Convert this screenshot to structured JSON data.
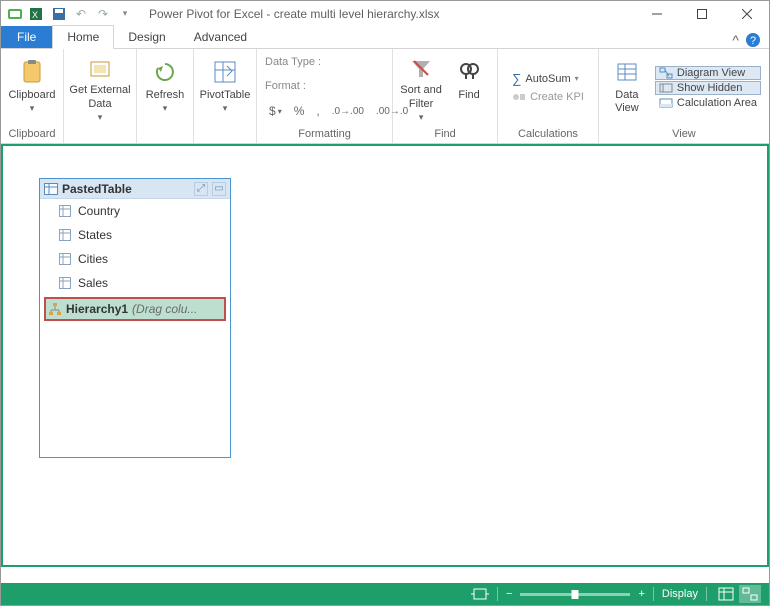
{
  "title": "Power Pivot for Excel - create multi level hierarchy.xlsx",
  "tabs": {
    "file": "File",
    "home": "Home",
    "design": "Design",
    "advanced": "Advanced"
  },
  "ribbon": {
    "clipboard": {
      "label": "Clipboard",
      "btn": "Clipboard"
    },
    "getdata": "Get External\nData",
    "refresh": "Refresh",
    "pivot": "PivotTable",
    "format": {
      "groupLabel": "Formatting",
      "dataType": "Data Type :",
      "format": "Format :"
    },
    "sortfilter": {
      "label": "Find",
      "sort": "Sort and\nFilter",
      "find": "Find"
    },
    "find_group": "Find",
    "calc": {
      "label": "Calculations",
      "autosum": "AutoSum",
      "kpi": "Create KPI"
    },
    "view": {
      "label": "View",
      "dataview": "Data\nView",
      "diagram": "Diagram View",
      "showhidden": "Show Hidden",
      "calcarea": "Calculation Area"
    }
  },
  "table": {
    "name": "PastedTable",
    "fields": [
      "Country",
      "States",
      "Cities",
      "Sales"
    ],
    "hierarchy": {
      "name": "Hierarchy1",
      "hint": "(Drag colu..."
    }
  },
  "status": {
    "display": "Display"
  }
}
